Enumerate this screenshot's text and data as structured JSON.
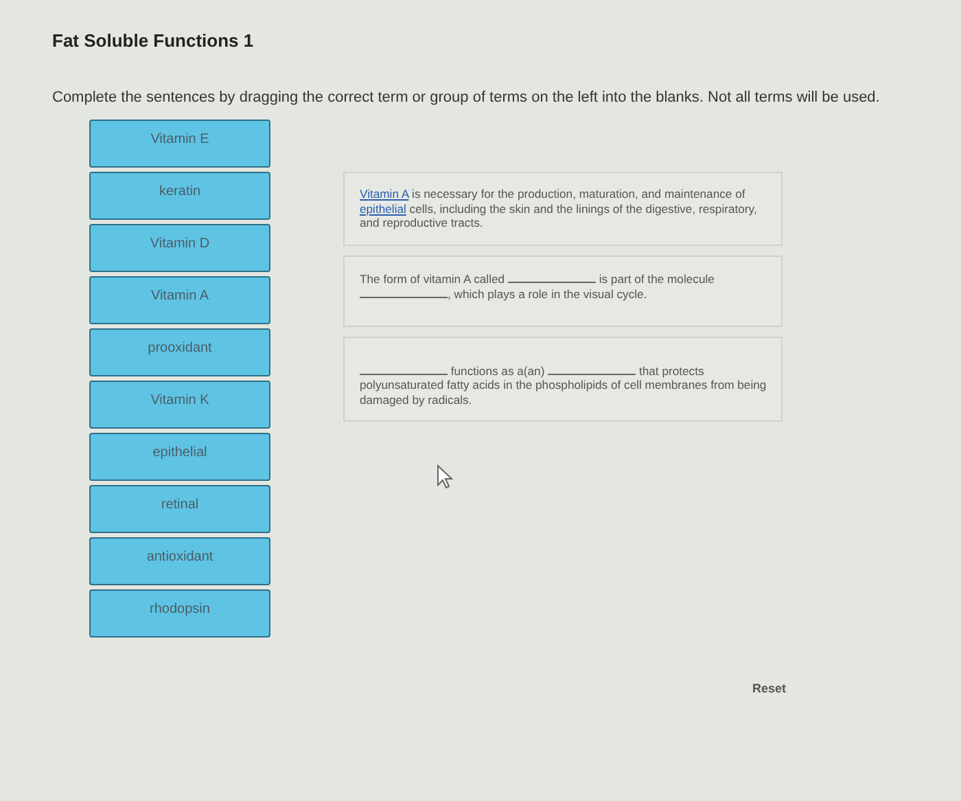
{
  "title": "Fat Soluble Functions 1",
  "instructions": "Complete the sentences by dragging the correct term or group of terms on the left into the blanks. Not all terms will be used.",
  "terms": [
    "Vitamin E",
    "keratin",
    "Vitamin D",
    "Vitamin A",
    "prooxidant",
    "Vitamin K",
    "epithelial",
    "retinal",
    "antioxidant",
    "rhodopsin"
  ],
  "sentences": [
    {
      "parts": [
        {
          "kind": "filled",
          "text": "Vitamin A"
        },
        {
          "kind": "text",
          "text": " is necessary for the production, maturation, and maintenance of "
        },
        {
          "kind": "filled",
          "text": "epithelial"
        },
        {
          "kind": "text",
          "text": " cells, including the skin and the linings of the digestive, respiratory, and reproductive tracts."
        }
      ]
    },
    {
      "parts": [
        {
          "kind": "text",
          "text": "The form of vitamin A called "
        },
        {
          "kind": "blank"
        },
        {
          "kind": "text",
          "text": " is part of the molecule "
        },
        {
          "kind": "blank"
        },
        {
          "kind": "text",
          "text": ", which plays a role in the visual cycle."
        }
      ]
    },
    {
      "parts": [
        {
          "kind": "blank"
        },
        {
          "kind": "text",
          "text": " functions as a(an) "
        },
        {
          "kind": "blank"
        },
        {
          "kind": "text",
          "text": " that protects polyunsaturated fatty acids in the phospholipids of cell membranes from being damaged by radicals."
        }
      ]
    }
  ],
  "reset": "Reset"
}
